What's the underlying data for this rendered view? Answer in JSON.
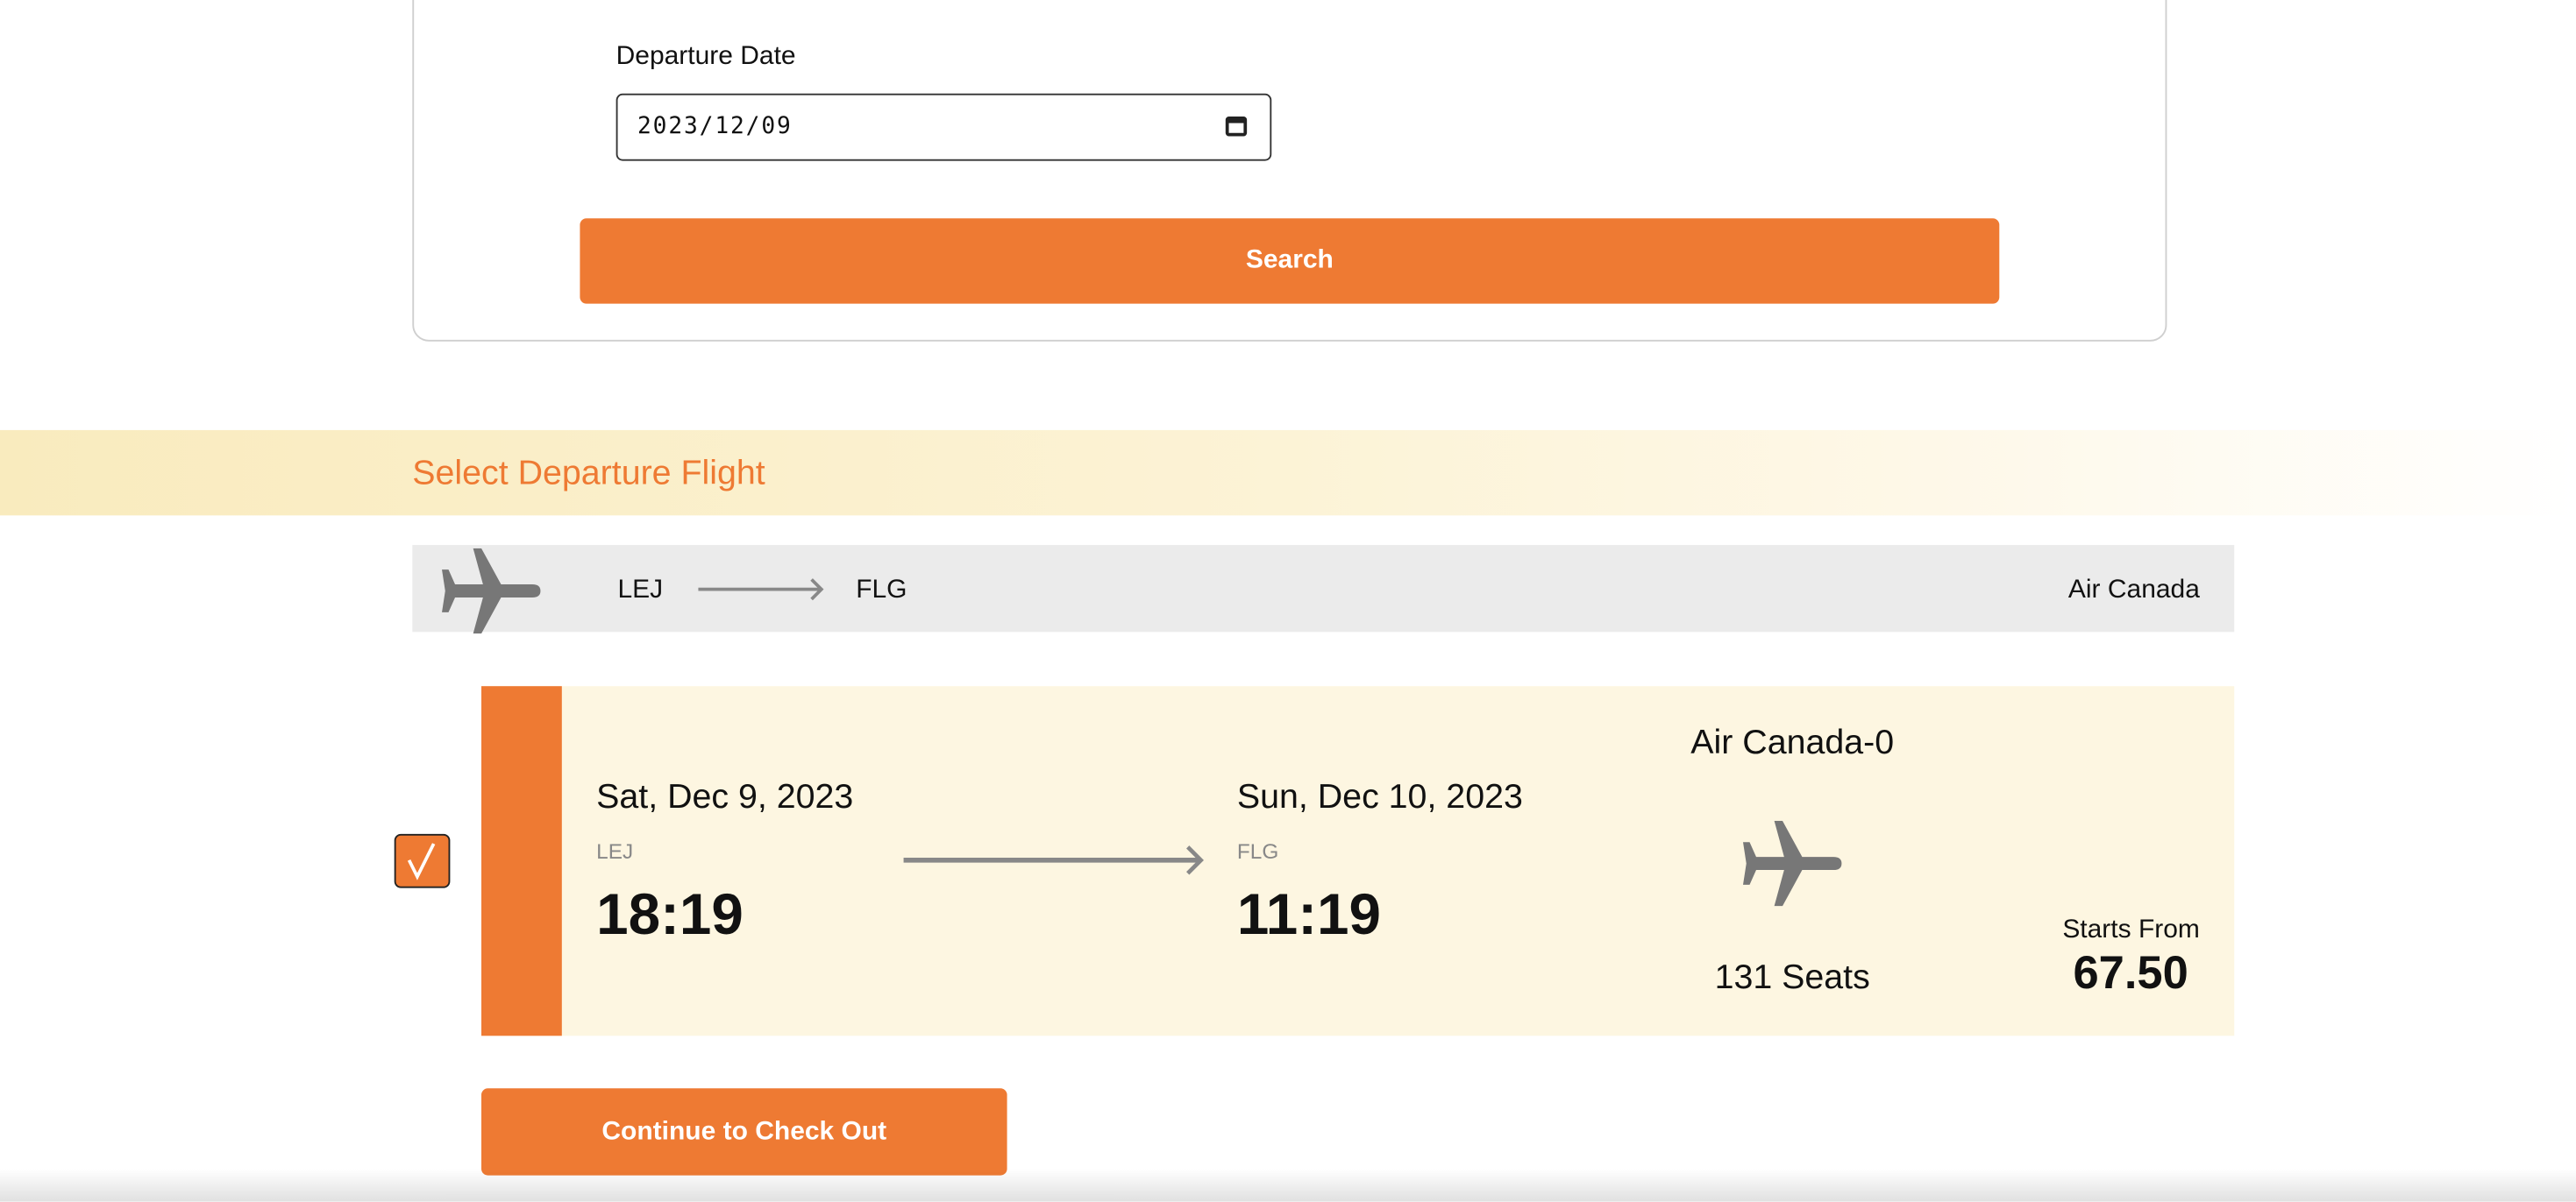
{
  "search_form": {
    "departure_label": "Departure Date",
    "departure_value": "2023/12/09",
    "search_label": "Search"
  },
  "results": {
    "section_title": "Select Departure Flight",
    "route": {
      "from": "LEJ",
      "to": "FLG",
      "airline": "Air Canada"
    },
    "flights": [
      {
        "selected": true,
        "depart_date": "Sat, Dec 9, 2023",
        "depart_code": "LEJ",
        "depart_time": "18:19",
        "arrive_date": "Sun, Dec 10, 2023",
        "arrive_code": "FLG",
        "arrive_time": "11:19",
        "flight_name": "Air Canada-0",
        "seats": "131 Seats",
        "price_label": "Starts From",
        "price": "67.50"
      }
    ],
    "continue_label": "Continue to Check Out"
  },
  "colors": {
    "accent": "#EE7A33",
    "card_bg": "#FDF6E1",
    "route_bg": "#EBEBEB",
    "icon_gray": "#777777"
  }
}
